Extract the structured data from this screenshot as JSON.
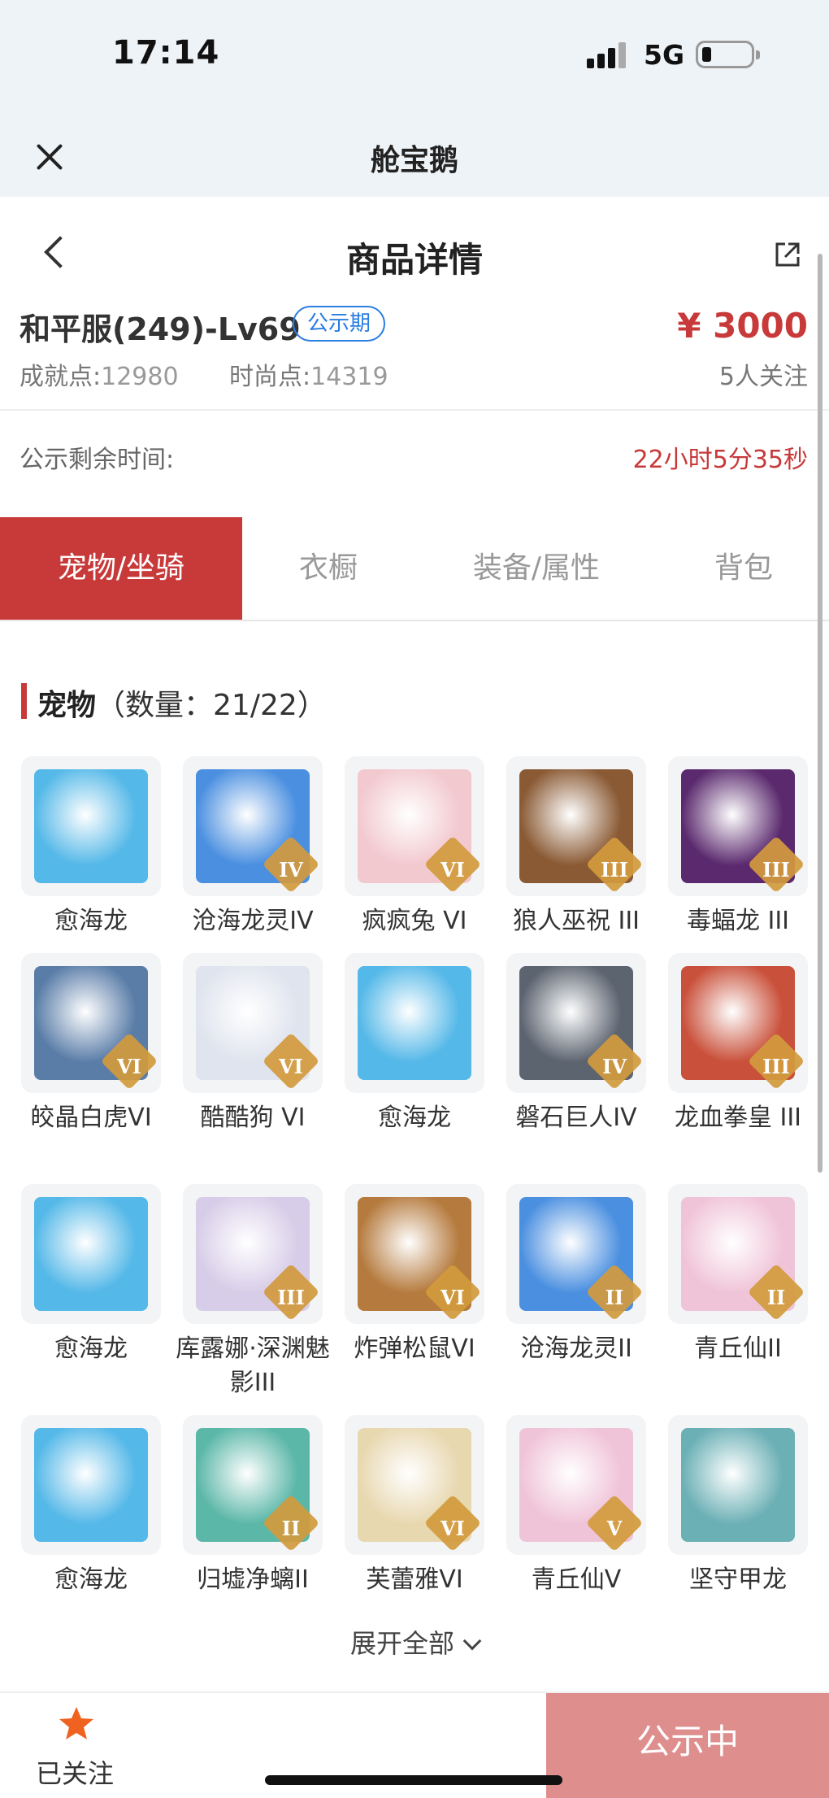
{
  "status_bar": {
    "time": "17:14",
    "network": "5G",
    "battery_level": 0.15
  },
  "app_bar": {
    "title": "舱宝鹅"
  },
  "header": {
    "title": "商品详情"
  },
  "product": {
    "name": "和平服(249)-Lv69",
    "badge": "公示期",
    "price": "¥ 3000",
    "achievement_label": "成就点:",
    "achievement_value": "12980",
    "fashion_label": "时尚点:",
    "fashion_value": "14319",
    "followers": "5人关注"
  },
  "countdown": {
    "label": "公示剩余时间:",
    "value": "22小时5分35秒"
  },
  "tabs": [
    {
      "label": "宠物/坐骑",
      "active": true
    },
    {
      "label": "衣橱",
      "active": false
    },
    {
      "label": "装备/属性",
      "active": false
    },
    {
      "label": "背包",
      "active": false
    }
  ],
  "pets_section": {
    "title": "宠物",
    "count": "（数量：21/22）"
  },
  "pets": [
    {
      "name": "愈海龙",
      "rank": "",
      "color": "#54b8e8"
    },
    {
      "name": "沧海龙灵IV",
      "rank": "IV",
      "color": "#4a8fe0"
    },
    {
      "name": "疯疯兔 VI",
      "rank": "VI",
      "color": "#f2c9cf"
    },
    {
      "name": "狼人巫祝 III",
      "rank": "III",
      "color": "#8a5a34"
    },
    {
      "name": "毒蝠龙 III",
      "rank": "III",
      "color": "#5b2a6e"
    },
    {
      "name": "皎晶白虎VI",
      "rank": "VI",
      "color": "#5a7da8"
    },
    {
      "name": "酷酷狗 VI",
      "rank": "VI",
      "color": "#e0e4ee"
    },
    {
      "name": "愈海龙",
      "rank": "",
      "color": "#54b8e8"
    },
    {
      "name": "磐石巨人IV",
      "rank": "IV",
      "color": "#5c6470"
    },
    {
      "name": "龙血拳皇 III",
      "rank": "III",
      "color": "#c9503a"
    },
    {
      "name": "愈海龙",
      "rank": "",
      "color": "#54b8e8"
    },
    {
      "name": "库露娜·深渊魅影III",
      "rank": "III",
      "color": "#d8cde8"
    },
    {
      "name": "炸弹松鼠VI",
      "rank": "VI",
      "color": "#b57a3d"
    },
    {
      "name": "沧海龙灵II",
      "rank": "II",
      "color": "#4a8fe0"
    },
    {
      "name": "青丘仙II",
      "rank": "II",
      "color": "#f0c4d8"
    },
    {
      "name": "愈海龙",
      "rank": "",
      "color": "#54b8e8"
    },
    {
      "name": "归墟净螭II",
      "rank": "II",
      "color": "#5bb7a8"
    },
    {
      "name": "芙蕾雅VI",
      "rank": "VI",
      "color": "#e8d8b0"
    },
    {
      "name": "青丘仙V",
      "rank": "V",
      "color": "#f0c4d8"
    },
    {
      "name": "坚守甲龙",
      "rank": "",
      "color": "#6bb0b5"
    }
  ],
  "expand_label": "展开全部",
  "bottom_bar": {
    "follow_label": "已关注",
    "status_label": "公示中"
  },
  "colors": {
    "accent": "#c8393a",
    "badge_blue": "#2a7de1",
    "status_button": "#df8e8e",
    "star": "#f0621f"
  }
}
